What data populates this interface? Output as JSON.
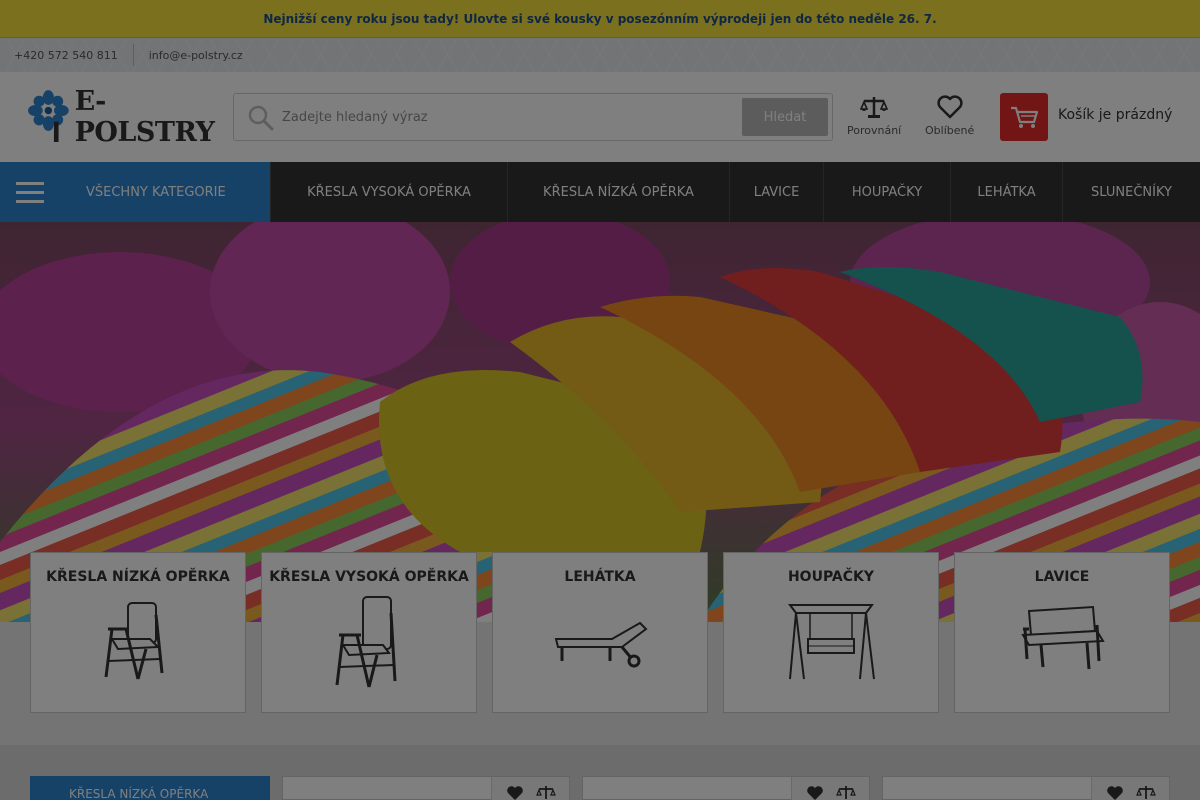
{
  "promo": "Nejnižší ceny roku jsou tady! Ulovte si své kousky v posezónním výprodeji jen do této neděle 26. 7.",
  "contact": {
    "phone": "+420 572 540 811",
    "email": "info@e-polstry.cz"
  },
  "header": {
    "logo_text": "E-POLSTRY",
    "search_placeholder": "Zadejte hledaný výraz",
    "search_button": "Hledat",
    "compare_label": "Porovnání",
    "favorites_label": "Oblíbené",
    "cart_text": "Košík je prázdný"
  },
  "nav": {
    "all_categories": "VŠECHNY KATEGORIE",
    "items": [
      "KŘESLA VYSOKÁ OPĚRKA",
      "KŘESLA NÍZKÁ OPĚRKA",
      "LAVICE",
      "HOUPAČKY",
      "LEHÁTKA",
      "SLUNEČNÍKY"
    ]
  },
  "categories": [
    "KŘESLA NÍZKÁ OPĚRKA",
    "KŘESLA VYSOKÁ OPĚRKA",
    "LEHÁTKA",
    "HOUPAČKY",
    "LAVICE"
  ],
  "section_label": "KŘESLA NÍZKÁ OPĚRKA",
  "colors": {
    "accent_blue": "#2f84cf",
    "cart_red": "#e32a2a",
    "promo_yellow": "#f5e03a",
    "nav_dark": "#333333"
  }
}
